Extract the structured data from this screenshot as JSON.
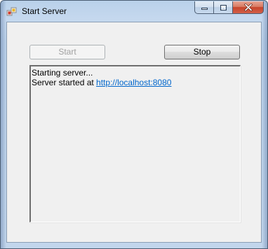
{
  "window": {
    "title": "Start Server"
  },
  "icons": {
    "app": "application-icon",
    "minimize": "minimize-icon",
    "maximize": "maximize-icon",
    "close": "close-icon"
  },
  "buttons": {
    "start_label": "Start",
    "start_enabled": false,
    "stop_label": "Stop"
  },
  "log": {
    "line1": "Starting server...",
    "line2_prefix": "Server started at ",
    "line2_link": "http://localhost:8080"
  },
  "colors": {
    "link": "#0066cc",
    "close_button": "#c7442a",
    "form_background": "#f0f0f0",
    "disabled_text": "#a0a0a0"
  }
}
